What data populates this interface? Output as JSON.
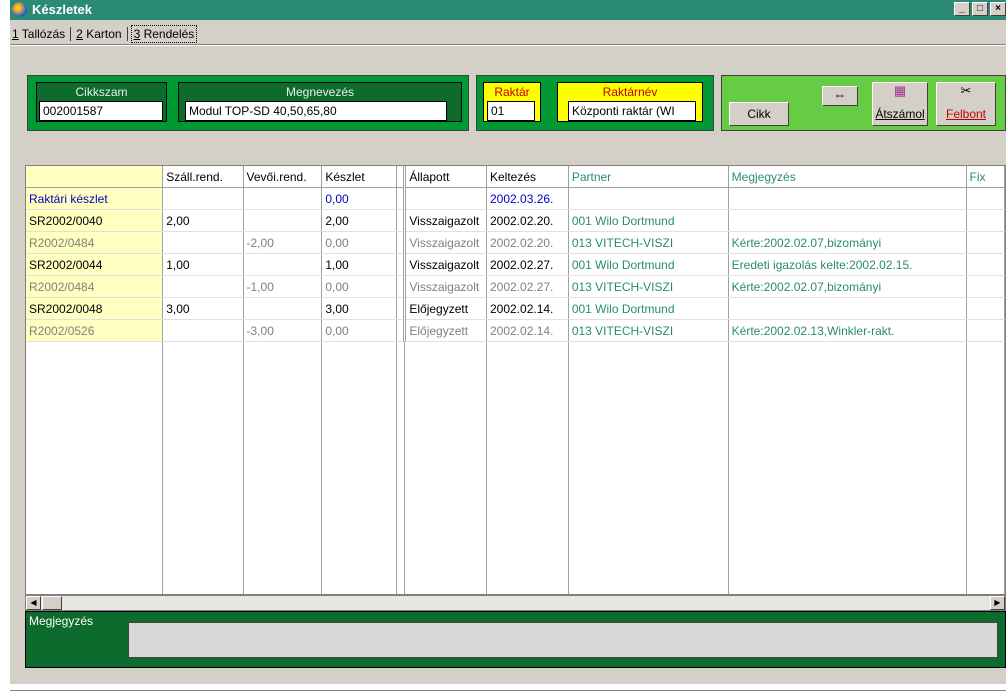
{
  "window": {
    "title": "Készletek",
    "controls": [
      "_",
      "□",
      "×"
    ]
  },
  "tabs": [
    {
      "num": "1",
      "label": " Tallózás",
      "active": false
    },
    {
      "num": "2",
      "label": " Karton",
      "active": false
    },
    {
      "num": "3",
      "label": " Rendelés",
      "active": true
    }
  ],
  "header": {
    "cikkszam_label": "Cikkszam",
    "cikkszam_value": "002001587",
    "megnevezes_label": "Megnevezés",
    "megnevezes_value": "Modul TOP-SD 40,50,65,80",
    "raktar_label": "Raktár",
    "raktar_value": "01",
    "raktarnev_label": "Raktárnév",
    "raktarnev_value": "Központi raktár (WI"
  },
  "toolbar": {
    "cikk_label": "Cikk",
    "atszamol_label": "Átszámol",
    "felbont_label": "Felbont",
    "swap_icon": "⇔",
    "calc_icon": "▦",
    "scissors_icon": "✂"
  },
  "colors": {
    "title_bar": "#2a8a76",
    "panel_green": "#009933",
    "panel_dark": "#0d6b2e",
    "panel_light": "#66cc44",
    "highlight_yellow": "#ffff00"
  },
  "grid": {
    "columns": [
      "",
      "Száll.rend.",
      "Vevői.rend.",
      "Készlet",
      "",
      "Állapott",
      "Keltezés",
      "Partner",
      "Megjegyzés",
      "Fix"
    ],
    "rows": [
      {
        "type": "stock",
        "cells": [
          "Raktári készlet",
          "",
          "",
          "0,00",
          "",
          "",
          "2002.03.26.",
          "",
          "",
          ""
        ]
      },
      {
        "type": "main",
        "cells": [
          "SR2002/0040",
          "2,00",
          "",
          "2,00",
          "",
          "Visszaigazolt",
          "2002.02.20.",
          "001 Wilo Dortmund",
          "",
          ""
        ]
      },
      {
        "type": "sub",
        "cells": [
          "R2002/0484",
          "",
          "-2,00",
          "0,00",
          "",
          "Visszaigazolt",
          "2002.02.20.",
          "013 VITECH-VISZI",
          "Kérte:2002.02.07,bizományi",
          ""
        ]
      },
      {
        "type": "main",
        "cells": [
          "SR2002/0044",
          "1,00",
          "",
          "1,00",
          "",
          "Visszaigazolt",
          "2002.02.27.",
          "001 Wilo Dortmund",
          " Eredeti igazolás kelte:2002.02.15.",
          ""
        ]
      },
      {
        "type": "sub",
        "cells": [
          "R2002/0484",
          "",
          "-1,00",
          "0,00",
          "",
          "Visszaigazolt",
          "2002.02.27.",
          "013 VITECH-VISZI",
          "Kérte:2002.02.07,bizományi",
          ""
        ]
      },
      {
        "type": "main",
        "cells": [
          "SR2002/0048",
          "3,00",
          "",
          "3,00",
          "",
          "Előjegyzett",
          "2002.02.14.",
          "001 Wilo Dortmund",
          "",
          ""
        ]
      },
      {
        "type": "sub",
        "cells": [
          "R2002/0526",
          "",
          "-3,00",
          "0,00",
          "",
          "Előjegyzett",
          "2002.02.14.",
          "013 VITECH-VISZI",
          "Kérte:2002.02.13,Winkler-rakt.",
          ""
        ]
      }
    ]
  },
  "notes": {
    "label": "Megjegyzés",
    "value": ""
  }
}
